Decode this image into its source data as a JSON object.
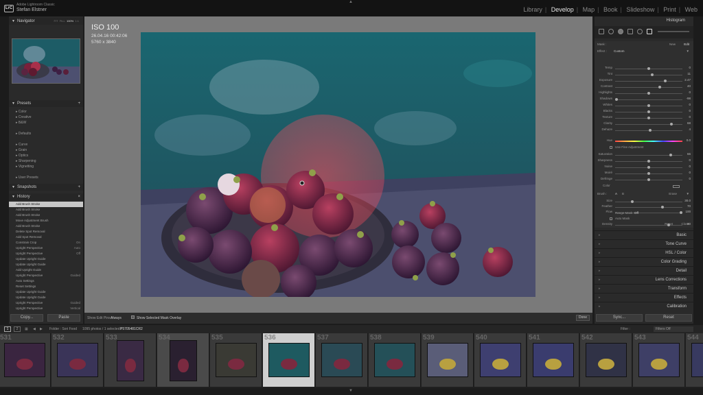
{
  "app": {
    "line1": "Adobe Lightroom Classic",
    "user": "Stefan Elstner"
  },
  "modules": [
    "Library",
    "Develop",
    "Map",
    "Book",
    "Slideshow",
    "Print",
    "Web"
  ],
  "active_module": "Develop",
  "left": {
    "navigator": {
      "title": "Navigator",
      "modes": [
        "FIT",
        "FILL",
        "100%",
        "1:1"
      ]
    },
    "presets": {
      "title": "Presets",
      "groups": [
        "Color",
        "Creative",
        "B&W"
      ],
      "groups2": [
        "Defaults"
      ],
      "groups3": [
        "Curve",
        "Grain",
        "Optics",
        "Sharpening",
        "Vignetting"
      ],
      "user": "User Presets"
    },
    "snapshots": {
      "title": "Snapshots"
    },
    "history": {
      "title": "History",
      "items": [
        {
          "label": "Add Brush Stroke",
          "value": ""
        },
        {
          "label": "Add Brush Stroke",
          "value": ""
        },
        {
          "label": "Add Brush Stroke",
          "value": ""
        },
        {
          "label": "Move Adjustment Brush",
          "value": ""
        },
        {
          "label": "Add Brush Stroke",
          "value": ""
        },
        {
          "label": "Delete Spot Removal",
          "value": ""
        },
        {
          "label": "Add Spot Removal",
          "value": ""
        },
        {
          "label": "Constrain Crop",
          "value": "On"
        },
        {
          "label": "Upright Perspective",
          "value": "Auto"
        },
        {
          "label": "Upright Perspective",
          "value": "Off"
        },
        {
          "label": "Update Upright Guide",
          "value": ""
        },
        {
          "label": "Update Upright Guide",
          "value": ""
        },
        {
          "label": "Add Upright Guide",
          "value": ""
        },
        {
          "label": "Upright Perspective",
          "value": "Guided"
        },
        {
          "label": "Auto Settings",
          "value": ""
        },
        {
          "label": "Reset Settings",
          "value": ""
        },
        {
          "label": "Update Upright Guide",
          "value": ""
        },
        {
          "label": "Update Upright Guide",
          "value": ""
        },
        {
          "label": "Upright Perspective",
          "value": "Guided"
        },
        {
          "label": "Upright Perspective",
          "value": "Vertical"
        }
      ]
    },
    "copy": "Copy...",
    "paste": "Paste"
  },
  "photo": {
    "iso": "ISO 100",
    "date": "26.04.16 00:42:06",
    "size": "5760 x 3840"
  },
  "toolbar": {
    "show_pins_label": "Show Edit Pins :",
    "show_pins_value": "Always",
    "mask_overlay": "Show Selected Mask Overlay",
    "done": "Done"
  },
  "right": {
    "histogram": "Histogram",
    "mask_label": "Mask :",
    "mask_new": "New",
    "mask_edit": "Edit",
    "effect_label": "Effect :",
    "effect_value": "Custom",
    "sliders": [
      {
        "label": "Temp",
        "value": "0",
        "pos": 0.5
      },
      {
        "label": "Tint",
        "value": "11",
        "pos": 0.55
      },
      {
        "label": "Exposure",
        "value": "2.47",
        "pos": 0.74
      },
      {
        "label": "Contrast",
        "value": "40",
        "pos": 0.66
      },
      {
        "label": "Highlights",
        "value": "0",
        "pos": 0.5
      },
      {
        "label": "Shadows",
        "value": "-98",
        "pos": 0.02
      },
      {
        "label": "Whites",
        "value": "0",
        "pos": 0.5
      },
      {
        "label": "Blacks",
        "value": "0",
        "pos": 0.5
      },
      {
        "label": "Texture",
        "value": "0",
        "pos": 0.5
      },
      {
        "label": "Clarity",
        "value": "68",
        "pos": 0.84
      },
      {
        "label": "Dehaze",
        "value": "4",
        "pos": 0.52
      }
    ],
    "hue_label": "Hue",
    "hue_value": "0.0",
    "fine_adj": "Use Fine Adjustment",
    "sliders2": [
      {
        "label": "Saturation",
        "value": "66",
        "pos": 0.83
      },
      {
        "label": "Sharpness",
        "value": "0",
        "pos": 0.5
      },
      {
        "label": "Noise",
        "value": "0",
        "pos": 0.5
      },
      {
        "label": "Moiré",
        "value": "0",
        "pos": 0.5
      },
      {
        "label": "Defringe",
        "value": "0",
        "pos": 0.5
      }
    ],
    "color_label": "Color",
    "brush_label": "Brush :",
    "brush_a": "A",
    "brush_b": "B",
    "brush_erase": "Erase",
    "sliders3": [
      {
        "label": "Size",
        "value": "30.0",
        "pos": 0.25
      },
      {
        "label": "Feather",
        "value": "70",
        "pos": 0.7
      },
      {
        "label": "Flow",
        "value": "100",
        "pos": 0.98
      }
    ],
    "automask": "Auto Mask",
    "density_label": "Density",
    "density_value": "80",
    "density_pos": 0.8,
    "range_mask": "Range Mask :",
    "range_mask_value": "Off",
    "reset": "Reset",
    "close": "Close",
    "sections": [
      "Basic",
      "Tone Curve",
      "HSL / Color",
      "Color Grading",
      "Detail",
      "Lens Corrections",
      "Transform",
      "Effects",
      "Calibration"
    ],
    "sync": "Sync...",
    "reset_btn": "Reset"
  },
  "filmstrip": {
    "folder": "Folder : Sori Food",
    "count": "1095 photos / 1 selected /",
    "filename": "P5705481CR2",
    "filter_label": "Filter :",
    "filter_value": "Filters Off",
    "cells": [
      "531",
      "532",
      "533",
      "534",
      "535",
      "536",
      "537",
      "538",
      "539",
      "540",
      "541",
      "542",
      "543",
      "544"
    ]
  }
}
